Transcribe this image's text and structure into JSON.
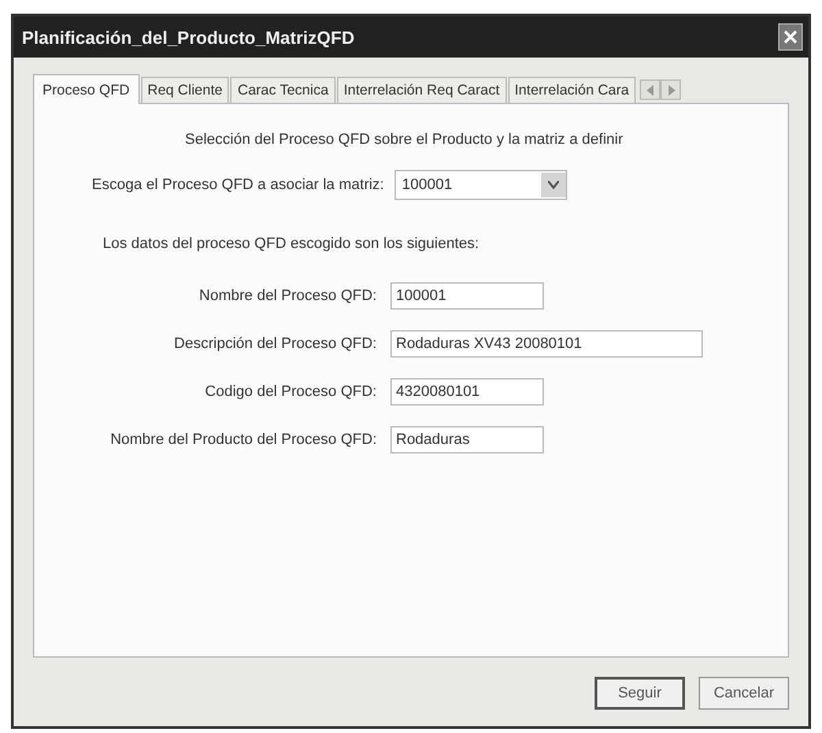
{
  "window": {
    "title": "Planificación_del_Producto_MatrizQFD"
  },
  "tabs": [
    {
      "label": "Proceso QFD",
      "selected": true
    },
    {
      "label": "Req Cliente",
      "selected": false
    },
    {
      "label": "Carac Tecnica",
      "selected": false
    },
    {
      "label": "Interrelación Req Caract",
      "selected": false
    },
    {
      "label": "Interrelación Cara",
      "selected": false
    }
  ],
  "heading": "Selección del Proceso QFD sobre el Producto y la matriz a definir",
  "selector": {
    "label": "Escoga el Proceso QFD a asociar la matriz:",
    "value": "100001"
  },
  "intro": "Los datos del proceso QFD escogido son los siguientes:",
  "fields": [
    {
      "label": "Nombre del Proceso QFD:",
      "value": "100001",
      "kind": "short"
    },
    {
      "label": "Descripción del Proceso QFD:",
      "value": "Rodaduras XV43 20080101",
      "kind": "long"
    },
    {
      "label": "Codigo del Proceso QFD:",
      "value": "4320080101",
      "kind": "short"
    },
    {
      "label": "Nombre del Producto del Proceso QFD:",
      "value": "Rodaduras",
      "kind": "short"
    }
  ],
  "buttons": [
    "Seguir",
    "Cancelar"
  ]
}
